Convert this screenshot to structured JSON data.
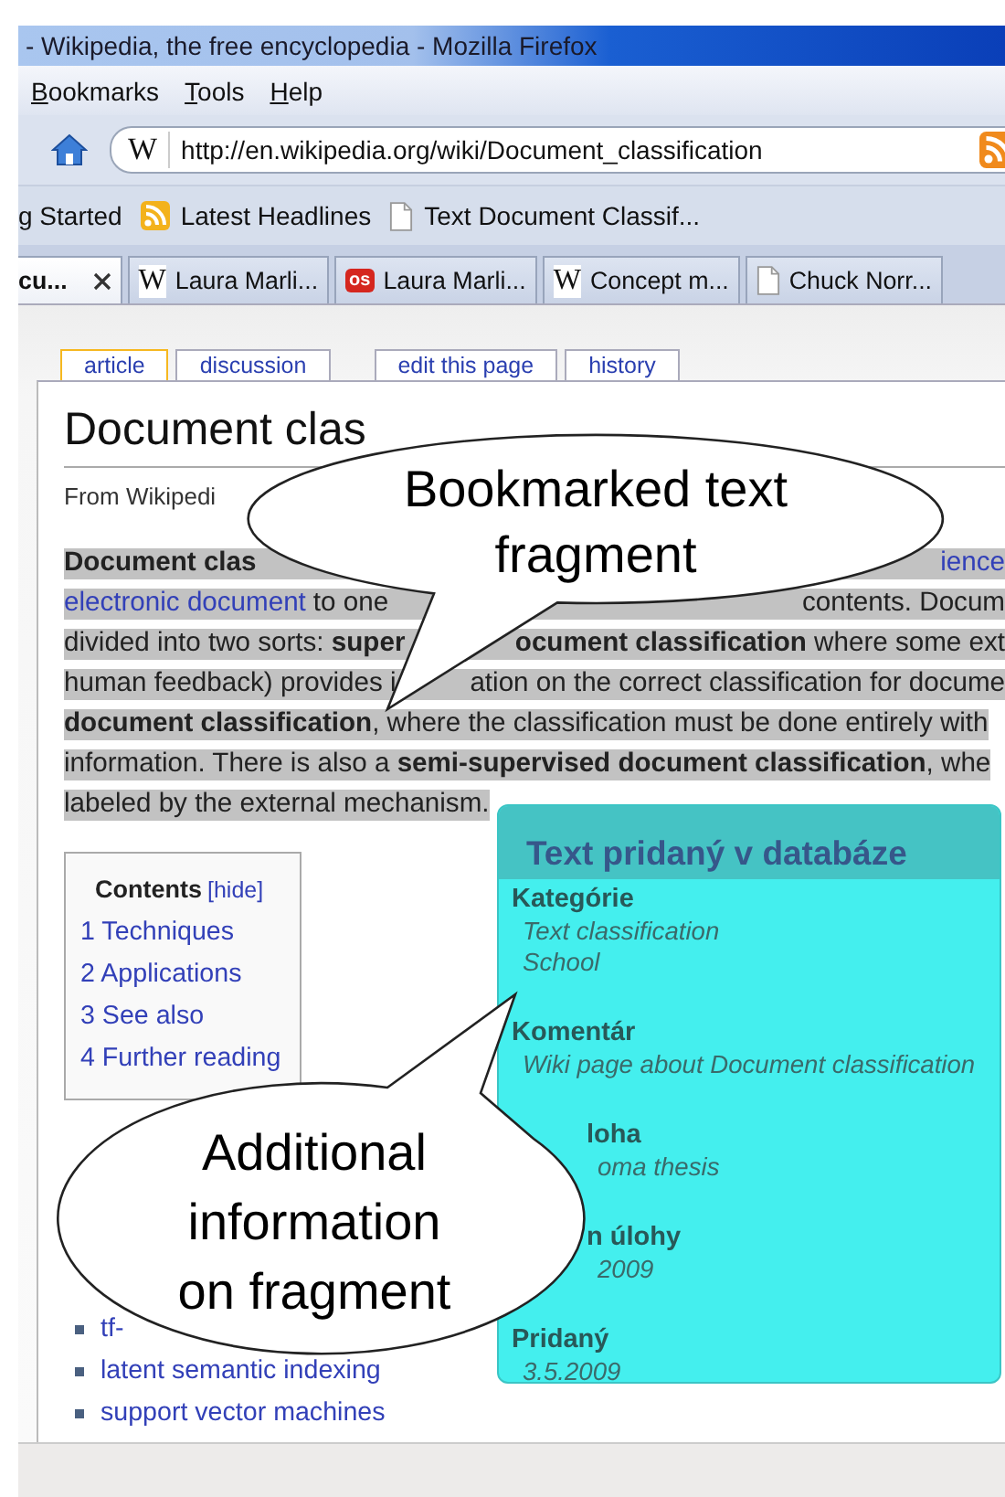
{
  "window": {
    "title": "- Wikipedia, the free encyclopedia - Mozilla Firefox"
  },
  "menu": [
    "Bookmarks",
    "Tools",
    "Help"
  ],
  "address": {
    "icon_text": "W",
    "url": "http://en.wikipedia.org/wiki/Document_classification"
  },
  "bookmarks": [
    {
      "label": "g Started",
      "kind": "plain"
    },
    {
      "label": "Latest Headlines",
      "kind": "feed"
    },
    {
      "label": "Text Document Classif...",
      "kind": "page"
    }
  ],
  "tabs": [
    {
      "label": "cu...",
      "selected": true,
      "kind": "plain",
      "closable": true
    },
    {
      "label": "Laura Marli...",
      "selected": false,
      "kind": "letter",
      "icon_text": "W"
    },
    {
      "label": "Laura Marli...",
      "selected": false,
      "kind": "badge",
      "icon_text": "os"
    },
    {
      "label": "Concept m...",
      "selected": false,
      "kind": "letter",
      "icon_text": "W"
    },
    {
      "label": "Chuck Norr...",
      "selected": false,
      "kind": "page"
    }
  ],
  "page_tabs": [
    {
      "label": "article",
      "selected": true
    },
    {
      "label": "discussion",
      "selected": false
    },
    {
      "label": "edit this page",
      "selected": false
    },
    {
      "label": "history",
      "selected": false
    }
  ],
  "article": {
    "title": "Document clas",
    "byline": "From Wikipedi",
    "highlighted": true,
    "lines": [
      {
        "start": [
          {
            "text": "**Document clas**",
            "link": false
          }
        ],
        "end": [
          {
            "text": "ience",
            "link": true
          }
        ]
      },
      {
        "start": [
          {
            "text": "electronic document",
            "link": true
          },
          {
            "text": "to one",
            "link": false
          }
        ],
        "end": [
          {
            "text": "contents. Docum",
            "link": false
          }
        ]
      },
      {
        "start": [
          {
            "text": "divided into two sorts: **super**",
            "link": false
          }
        ],
        "end": [
          {
            "text": "**ocument classification** where some ext",
            "link": false
          }
        ]
      },
      {
        "start": [
          {
            "text": "human feedback) provides i",
            "link": false
          }
        ],
        "end": [
          {
            "text": "ation on the correct classification for docume",
            "link": false
          }
        ]
      },
      {
        "start": [
          {
            "text": "**document classification**, where the classification must be done entirely with",
            "link": false
          }
        ]
      },
      {
        "start": [
          {
            "text": "information. There is also a **semi-supervised document classification**, whe",
            "link": false
          }
        ]
      },
      {
        "start": [
          {
            "text": "labeled by the external mechanism.",
            "link": false
          }
        ]
      }
    ]
  },
  "toc": {
    "title": "Contents",
    "toggle": "[hide]",
    "items": [
      "1 Techniques",
      "2 Applications",
      "3 See also",
      "4 Further reading"
    ]
  },
  "see_also": [
    "tf-",
    "latent semantic indexing",
    "support vector machines"
  ],
  "panel": {
    "title": "Text pridaný v databáze",
    "fields": [
      {
        "label": "Kategórie",
        "values": [
          "Text classification",
          "School"
        ]
      },
      {
        "label": "Komentár",
        "values": [
          "Wiki page about Document classification"
        ]
      },
      {
        "label": "loha",
        "values": [
          "oma thesis"
        ]
      },
      {
        "label": "n úlohy",
        "values": [
          "2009"
        ]
      },
      {
        "label": "Pridaný",
        "values": [
          "3.5.2009"
        ]
      }
    ]
  },
  "callouts": [
    {
      "text": "Bookmarked text fragment"
    },
    {
      "text": "Additional information on fragment"
    }
  ]
}
